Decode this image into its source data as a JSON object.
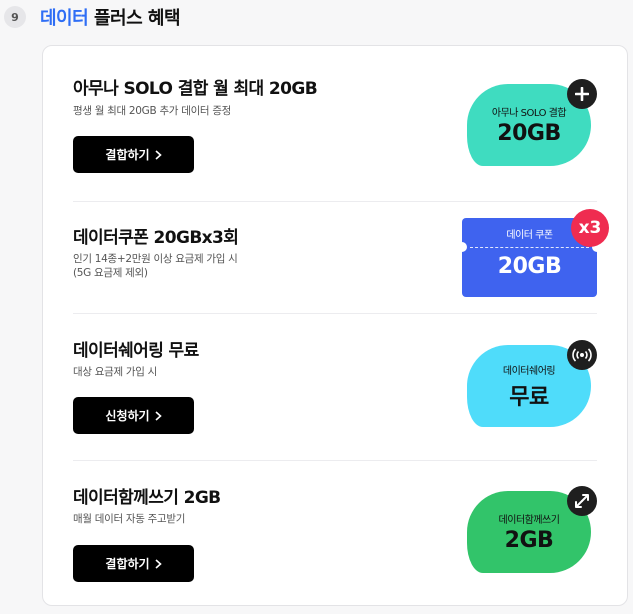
{
  "section": {
    "step_number": "9",
    "title_accent": "데이터",
    "title_rest": " 플러스 혜택"
  },
  "benefits": [
    {
      "title": "아무나 SOLO 결합 월 최대 20GB",
      "description": "평생 월 최대 20GB 추가 데이터 증정",
      "button_label": "결합하기",
      "badge_caption": "아무나 SOLO 결합",
      "badge_value": "20GB",
      "badge_color": "#3fdcc0",
      "badge_icon": "plus-icon"
    },
    {
      "title": "데이터쿠폰 20GBx3회",
      "description": "인기 14종+2만원 이상 요금제 가입 시\n(5G 요금제 제외)",
      "badge_caption": "데이터 쿠폰",
      "badge_value": "20GB",
      "badge_color": "#3f63ef",
      "badge_multiplier": "x3",
      "multiplier_color": "#ef2c50"
    },
    {
      "title": "데이터쉐어링 무료",
      "description": "대상 요금제 가입 시",
      "button_label": "신청하기",
      "badge_caption": "데이터쉐어링",
      "badge_value": "무료",
      "badge_color": "#4fdcfa",
      "badge_icon": "broadcast-icon"
    },
    {
      "title": "데이터함께쓰기 2GB",
      "description": "매월 데이터 자동 주고받기",
      "button_label": "결합하기",
      "badge_caption": "데이터함께쓰기",
      "badge_value": "2GB",
      "badge_color": "#32c46a",
      "badge_icon": "exchange-arrows-icon"
    }
  ]
}
